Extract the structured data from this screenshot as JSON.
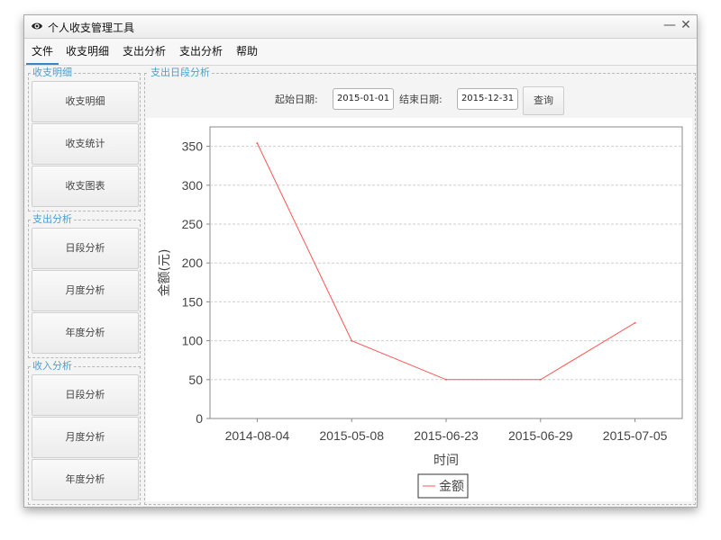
{
  "window": {
    "title": "个人收支管理工具",
    "minimize_glyph": "—",
    "close_glyph": "✕"
  },
  "menu": [
    "文件",
    "收支明细",
    "支出分析",
    "支出分析",
    "帮助"
  ],
  "sidebar": {
    "groups": [
      {
        "title": "收支明细",
        "items": [
          "收支明细",
          "收支统计",
          "收支图表"
        ]
      },
      {
        "title": "支出分析",
        "items": [
          "日段分析",
          "月度分析",
          "年度分析"
        ]
      },
      {
        "title": "收入分析",
        "items": [
          "日段分析",
          "月度分析",
          "年度分析"
        ]
      }
    ]
  },
  "main": {
    "title": "支出日段分析",
    "start_label": "起始日期:",
    "start_value": "2015-01-01",
    "end_label": "结束日期:",
    "end_value": "2015-12-31",
    "query_label": "查询"
  },
  "chart_data": {
    "type": "line",
    "categories": [
      "2014-08-04",
      "2015-05-08",
      "2015-06-23",
      "2015-06-29",
      "2015-07-05"
    ],
    "series": [
      {
        "name": "金额",
        "values": [
          354,
          100,
          50,
          50,
          123
        ],
        "color": "#ff5555"
      }
    ],
    "xlabel": "时间",
    "ylabel": "金额(元)",
    "ylim": [
      0,
      375
    ],
    "yticks": [
      0,
      50,
      100,
      150,
      200,
      250,
      300,
      350
    ],
    "grid": true,
    "legend": "bottom-center"
  }
}
